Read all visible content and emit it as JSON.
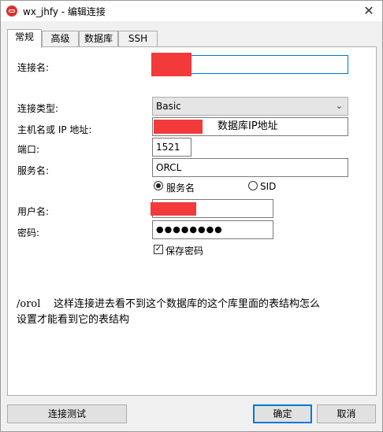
{
  "window": {
    "title": "wx_jhfy - 编辑连接",
    "close_symbol": "✕"
  },
  "tabs": [
    {
      "label": "常规",
      "active": true
    },
    {
      "label": "高级",
      "active": false
    },
    {
      "label": "数据库",
      "active": false
    },
    {
      "label": "SSH",
      "active": false
    }
  ],
  "form": {
    "connection_name_label": "连接名:",
    "connection_name_value": "",
    "connection_type_label": "连接类型:",
    "connection_type_value": "Basic",
    "host_label": "主机名或 IP 地址:",
    "host_value_annotation": "数据库IP地址",
    "port_label": "端口:",
    "port_value": "1521",
    "service_label": "服务名:",
    "service_value": "ORCL",
    "radio_service_name": "服务名",
    "radio_sid": "SID",
    "username_label": "用户名:",
    "password_label": "密码:",
    "password_value": "●●●●●●●●",
    "save_password_label": "保存密码",
    "save_password_checked": true
  },
  "note": {
    "lead": "/orol",
    "line1": "这样连接进去看不到这个数据库的这个库里面的表结构怎么",
    "line2": "设置才能看到它的表结构"
  },
  "buttons": {
    "test_connection": "连接测试",
    "ok": "确定",
    "cancel": "取消"
  },
  "colors": {
    "accent": "#0078d7",
    "redaction": "#f23a3a",
    "app_icon": "#d8302c"
  }
}
